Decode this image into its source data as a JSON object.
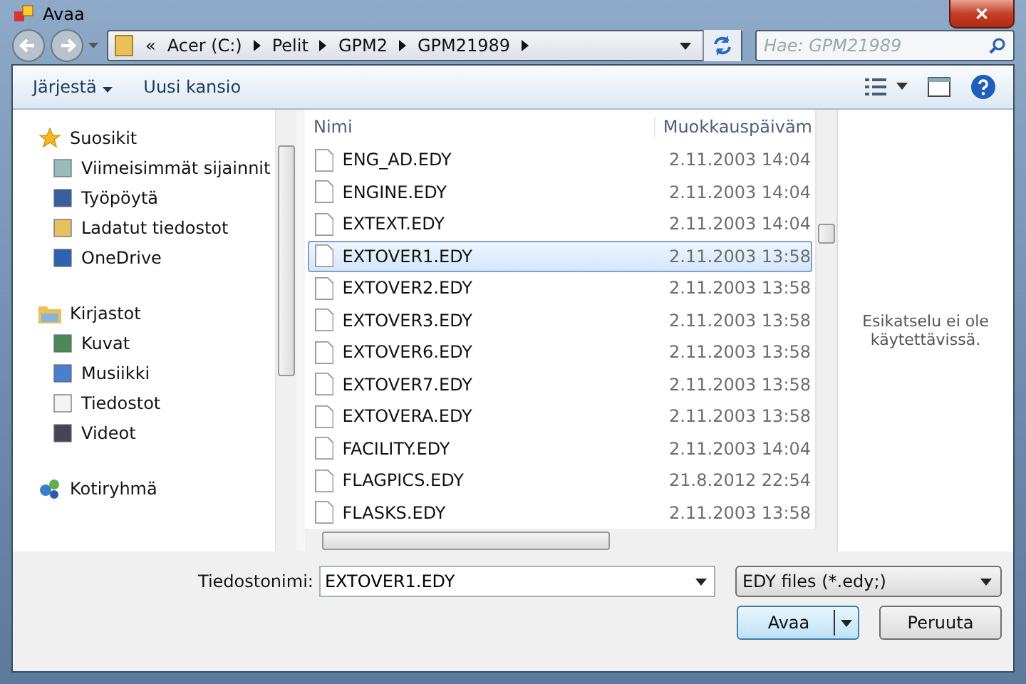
{
  "window": {
    "title": "Avaa",
    "close": "✕"
  },
  "address": {
    "overflow": "«",
    "crumbs": [
      "Acer (C:)",
      "Pelit",
      "GPM2",
      "GPM21989"
    ]
  },
  "search": {
    "placeholder": "Hae: GPM21989"
  },
  "toolbar": {
    "organize": "Järjestä",
    "new_folder": "Uusi kansio"
  },
  "sidebar": {
    "groups": [
      {
        "label": "Suosikit",
        "children": [
          {
            "label": "Viimeisimmät sijainnit"
          },
          {
            "label": "Työpöytä"
          },
          {
            "label": "Ladatut tiedostot"
          },
          {
            "label": "OneDrive"
          }
        ]
      },
      {
        "label": "Kirjastot",
        "children": [
          {
            "label": "Kuvat"
          },
          {
            "label": "Musiikki"
          },
          {
            "label": "Tiedostot"
          },
          {
            "label": "Videot"
          }
        ]
      },
      {
        "label": "Kotiryhmä"
      }
    ]
  },
  "table": {
    "columns": [
      "Nimi",
      "Muokkauspäiväm"
    ],
    "rows": [
      {
        "name": "ENG_AD.EDY",
        "date": "2.11.2003 14:04",
        "selected": false
      },
      {
        "name": "ENGINE.EDY",
        "date": "2.11.2003 14:04",
        "selected": false
      },
      {
        "name": "EXTEXT.EDY",
        "date": "2.11.2003 14:04",
        "selected": false
      },
      {
        "name": "EXTOVER1.EDY",
        "date": "2.11.2003 13:58",
        "selected": true
      },
      {
        "name": "EXTOVER2.EDY",
        "date": "2.11.2003 13:58",
        "selected": false
      },
      {
        "name": "EXTOVER3.EDY",
        "date": "2.11.2003 13:58",
        "selected": false
      },
      {
        "name": "EXTOVER6.EDY",
        "date": "2.11.2003 13:58",
        "selected": false
      },
      {
        "name": "EXTOVER7.EDY",
        "date": "2.11.2003 13:58",
        "selected": false
      },
      {
        "name": "EXTOVERA.EDY",
        "date": "2.11.2003 13:58",
        "selected": false
      },
      {
        "name": "FACILITY.EDY",
        "date": "2.11.2003 14:04",
        "selected": false
      },
      {
        "name": "FLAGPICS.EDY",
        "date": "21.8.2012 22:54",
        "selected": false
      },
      {
        "name": "FLASKS.EDY",
        "date": "2.11.2003 13:58",
        "selected": false
      }
    ]
  },
  "preview": {
    "message": "Esikatselu ei ole käytettävissä."
  },
  "footer": {
    "filename_label": "Tiedostonimi:",
    "filename": "EXTOVER1.EDY",
    "filter": "EDY files (*.edy;)",
    "open": "Avaa",
    "cancel": "Peruuta"
  }
}
